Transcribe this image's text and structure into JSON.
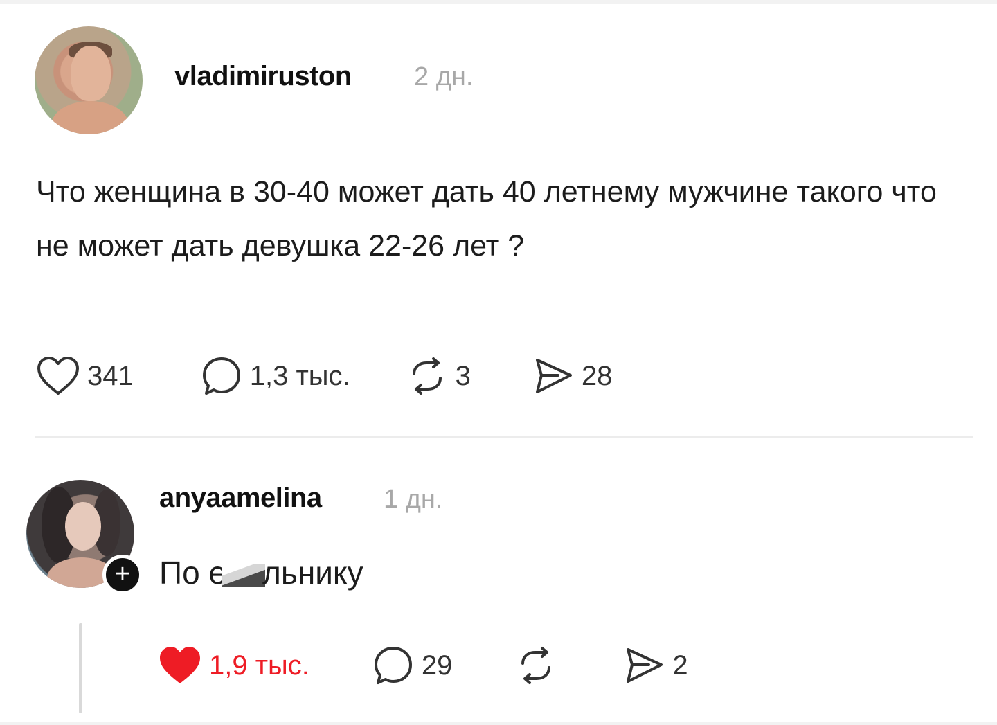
{
  "post": {
    "username": "vladimiruston",
    "time": "2 дн.",
    "text": "Что женщина в 30-40 может дать 40 летнему мужчине такого что не может дать девушка 22-26 лет ?",
    "likes": "341",
    "comments": "1,3 тыс.",
    "reposts": "3",
    "shares": "28"
  },
  "reply": {
    "username": "anyaamelina",
    "time": "1 дн.",
    "text_start": "По е",
    "text_end": "льнику",
    "likes": "1,9 тыс.",
    "comments": "29",
    "shares": "2",
    "follow_symbol": "+"
  },
  "colors": {
    "like_active": "#ee1c25",
    "muted": "#a8a8a8"
  },
  "icons": [
    "heart-icon",
    "comment-icon",
    "repost-icon",
    "share-icon",
    "plus-icon"
  ]
}
